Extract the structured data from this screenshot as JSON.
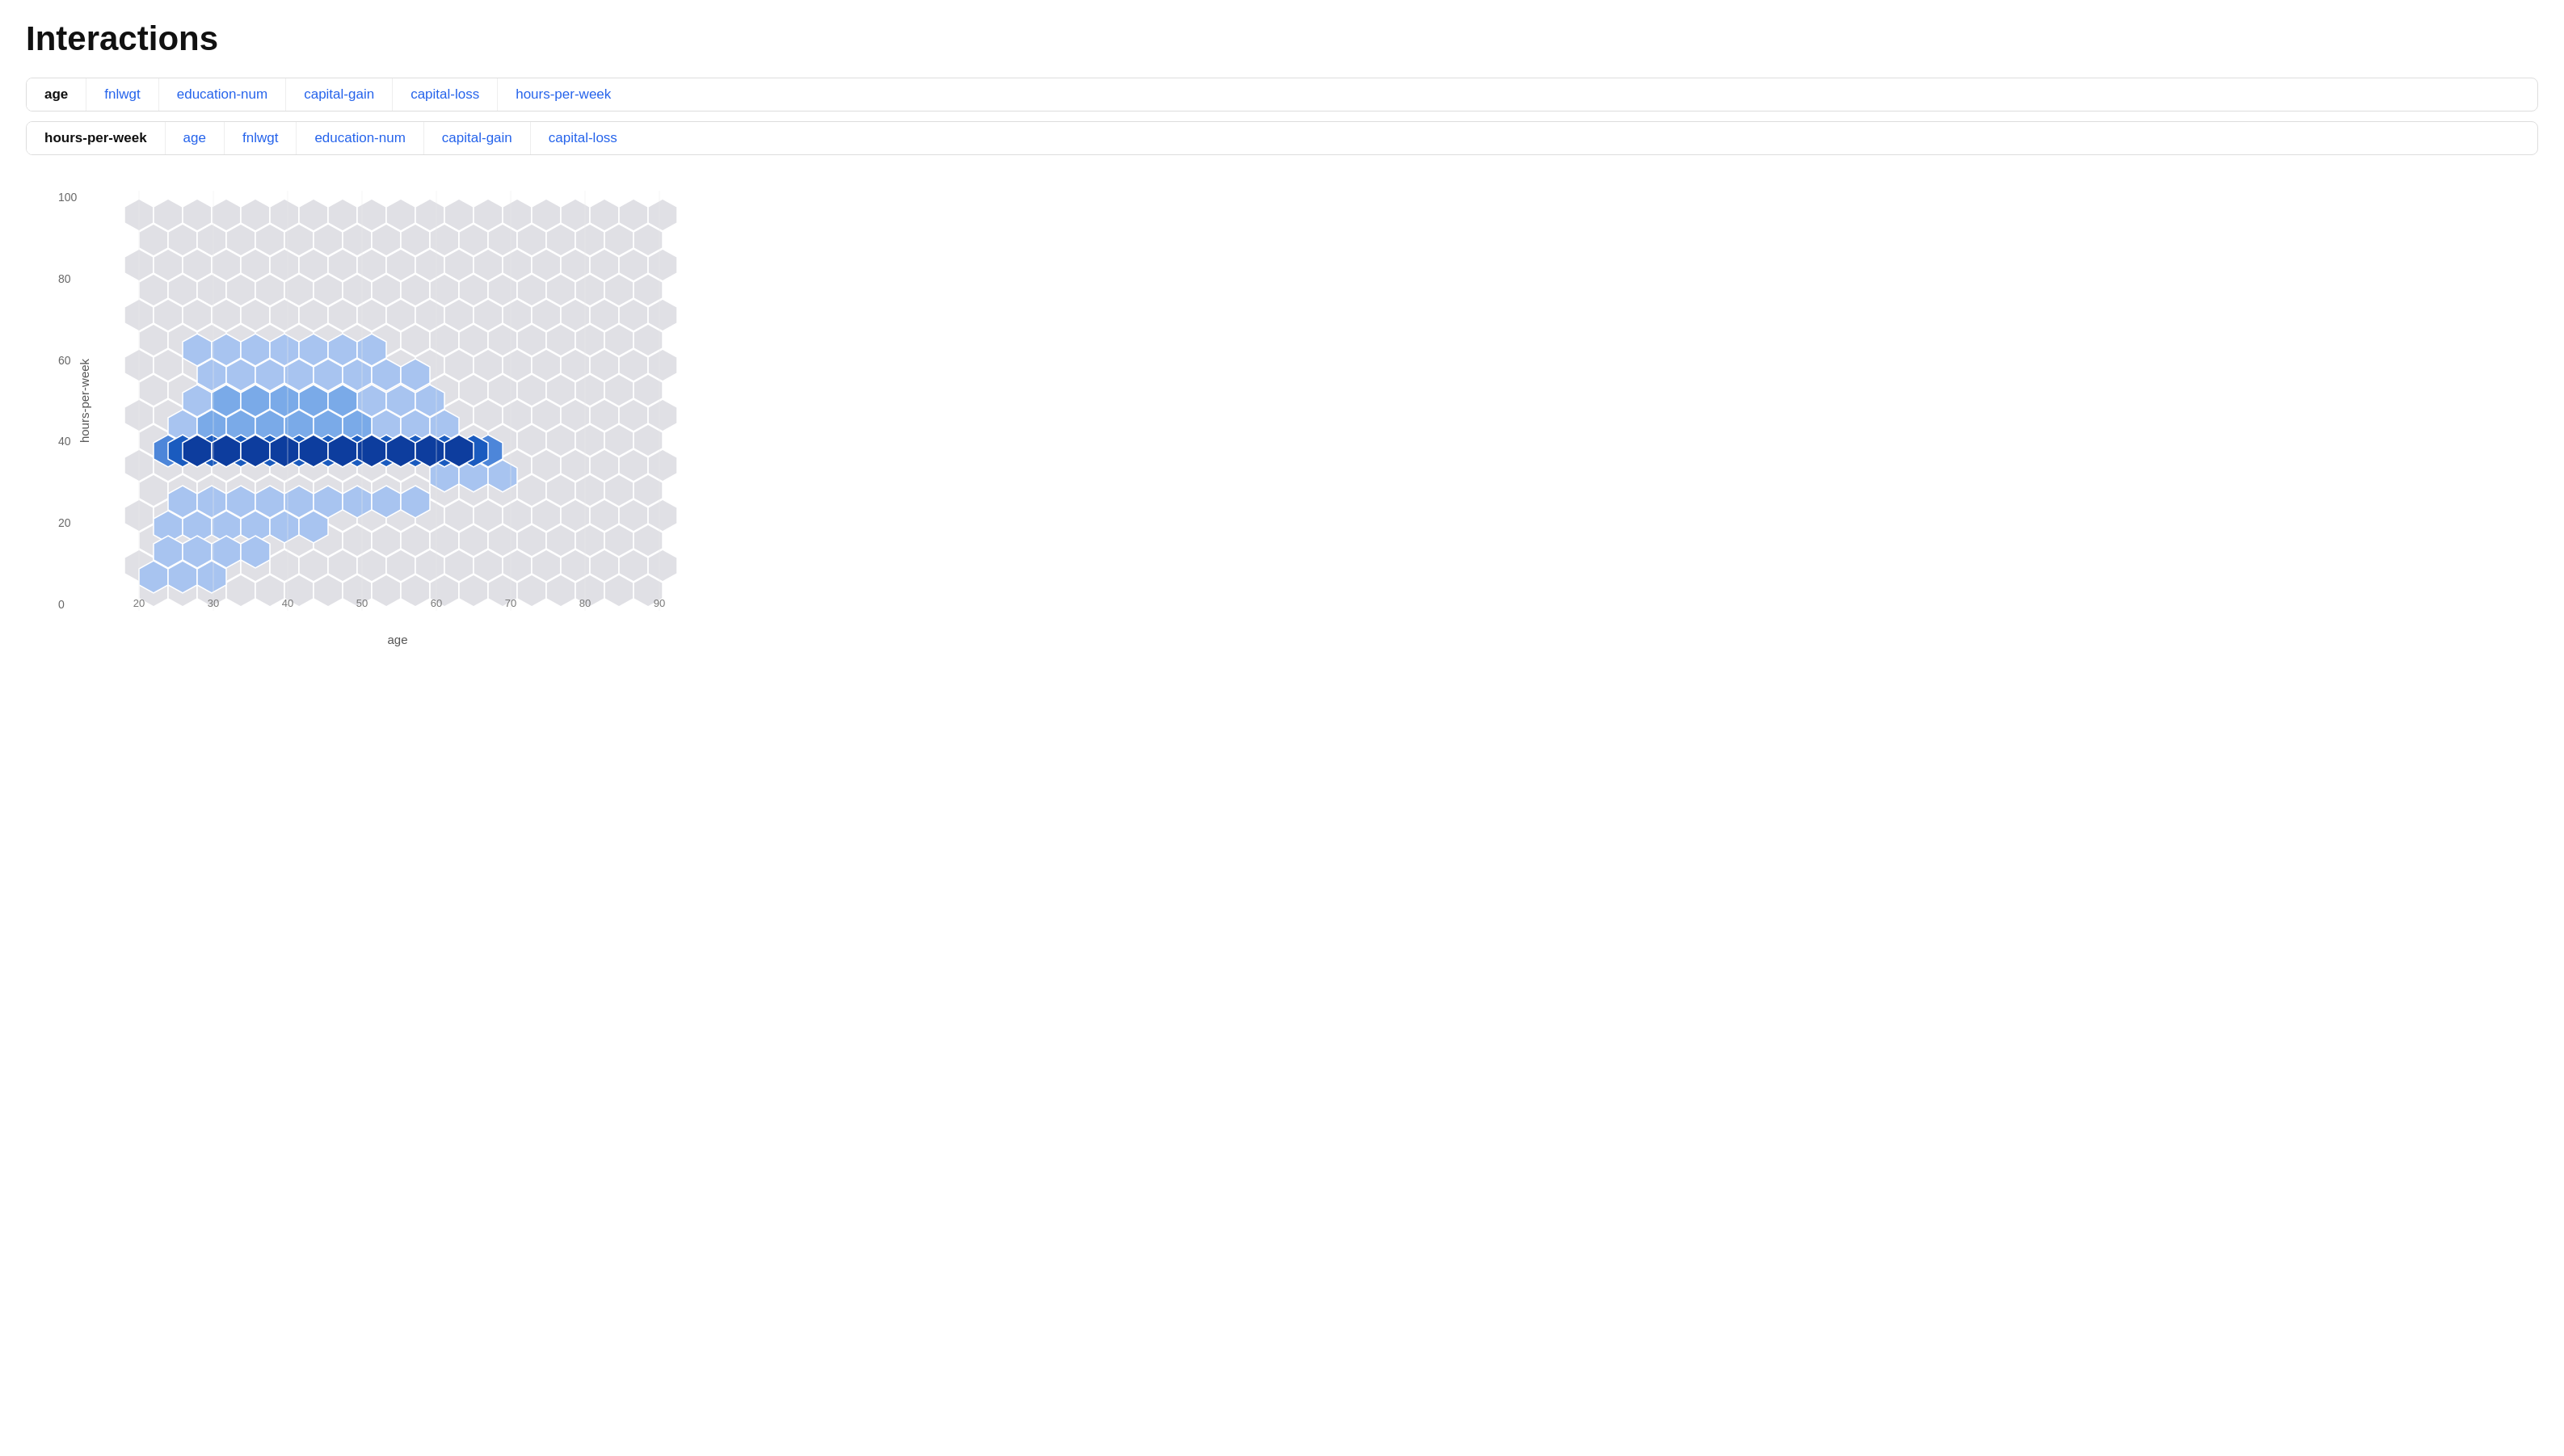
{
  "page": {
    "title": "Interactions"
  },
  "row1_tabs": {
    "items": [
      {
        "label": "age",
        "active": true
      },
      {
        "label": "fnlwgt",
        "active": false
      },
      {
        "label": "education-num",
        "active": false
      },
      {
        "label": "capital-gain",
        "active": false
      },
      {
        "label": "capital-loss",
        "active": false
      },
      {
        "label": "hours-per-week",
        "active": false
      }
    ]
  },
  "row2_tabs": {
    "items": [
      {
        "label": "hours-per-week",
        "active": true
      },
      {
        "label": "age",
        "active": false
      },
      {
        "label": "fnlwgt",
        "active": false
      },
      {
        "label": "education-num",
        "active": false
      },
      {
        "label": "capital-gain",
        "active": false
      },
      {
        "label": "capital-loss",
        "active": false
      }
    ]
  },
  "chart": {
    "x_label": "age",
    "y_label": "hours-per-week",
    "x_ticks": [
      "20",
      "30",
      "40",
      "50",
      "60",
      "70",
      "80",
      "90"
    ],
    "y_ticks": [
      "100",
      "80",
      "60",
      "40",
      "20",
      "0"
    ]
  }
}
